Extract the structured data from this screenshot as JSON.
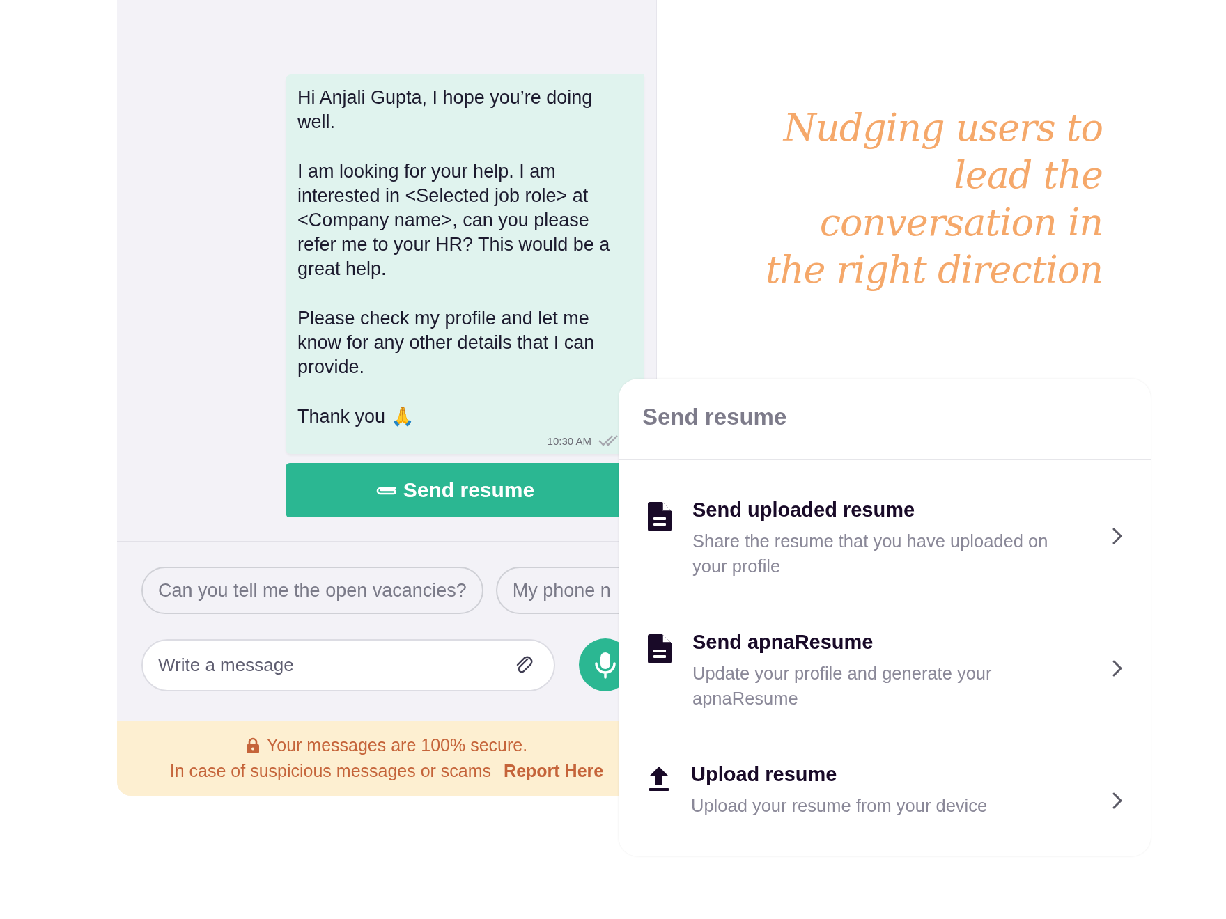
{
  "chat": {
    "message": {
      "paragraphs": [
        "Hi Anjali Gupta, I hope you’re doing well.",
        "I am looking for your help. I am interested in <Selected job role> at <Company name>, can you please refer me to your HR? This would be a great help.",
        "Please check my profile and let me know for any other details that I can provide.",
        "Thank you 🙏"
      ],
      "time": "10:30 AM"
    },
    "action_button": {
      "label": "Send resume"
    },
    "suggestions": [
      "Can you tell me the open vacancies?",
      "My phone n"
    ],
    "composer": {
      "placeholder": "Write a message"
    },
    "security_banner": {
      "line_1": "Your messages are 100% secure.",
      "line_2": "In case of suspicious messages or scams",
      "link": "Report Here"
    }
  },
  "tagline": [
    "Nudging users to",
    "lead the",
    "conversation in",
    "the right direction"
  ],
  "sheet": {
    "title": "Send resume",
    "options": [
      {
        "kind": "document",
        "title": "Send uploaded resume",
        "description": "Share the resume that you have uploaded on your profile"
      },
      {
        "kind": "document",
        "title": "Send apnaResume",
        "description": "Update your profile and generate your apnaResume"
      },
      {
        "kind": "upload",
        "title": "Upload resume",
        "description": "Upload your resume from your device"
      }
    ]
  }
}
